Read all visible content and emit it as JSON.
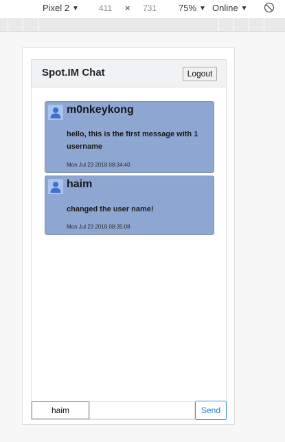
{
  "devtools": {
    "device_name": "Pixel 2",
    "width": "411",
    "times": "×",
    "height": "731",
    "zoom": "75%",
    "network": "Online",
    "caret": "▼"
  },
  "chat": {
    "title": "Spot.IM Chat",
    "logout_label": "Logout",
    "messages": [
      {
        "username": "m0nkeykong",
        "text": "hello, this is the first message with 1 username",
        "time": "Mon Jul 23 2018 08:34:40"
      },
      {
        "username": "haim",
        "text": "changed the user name!",
        "time": "Mon Jul 23 2018 08:35:08"
      }
    ],
    "footer": {
      "username_value": "haim",
      "message_value": "",
      "send_label": "Send"
    }
  },
  "colors": {
    "message_bg": "#8ea7d2",
    "send_accent": "#2a7fc8",
    "header_bg": "#f1f2f3"
  }
}
